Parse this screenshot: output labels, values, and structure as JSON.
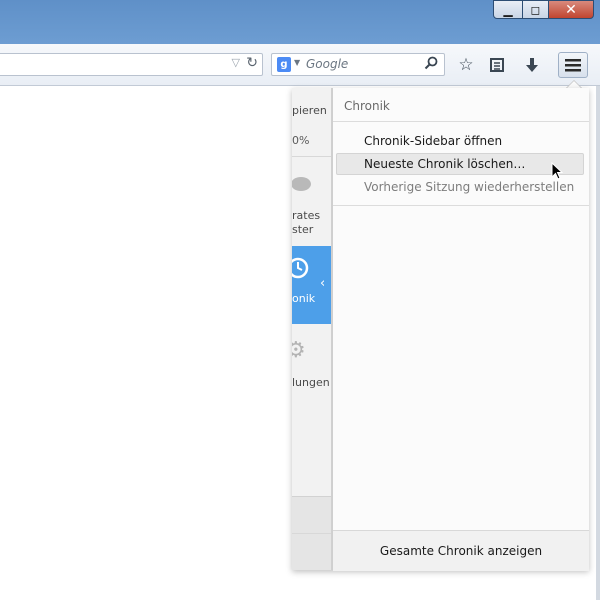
{
  "window": {
    "minimize_symbol": "▁",
    "maximize_symbol": "◻",
    "close_symbol": "✕"
  },
  "navbar": {
    "url_value": "",
    "search_placeholder": "Google",
    "search_engine_letter": "g"
  },
  "mainview": {
    "items": [
      {
        "label": "pieren"
      },
      {
        "label": "0%"
      },
      {
        "label": "rates"
      },
      {
        "label": "ster"
      },
      {
        "label": "onik"
      },
      {
        "label": "lungen"
      }
    ]
  },
  "subview": {
    "header": "Chronik",
    "items": [
      {
        "label": "Chronik-Sidebar öffnen",
        "state": "normal"
      },
      {
        "label": "Neueste Chronik löschen…",
        "state": "hover"
      },
      {
        "label": "Vorherige Sitzung wiederherstellen",
        "state": "disabled"
      }
    ],
    "footer": "Gesamte Chronik anzeigen"
  },
  "colors": {
    "titlebar": "#6d9dd2",
    "selected_tab": "#4d9fe9",
    "close_button": "#c14530"
  }
}
